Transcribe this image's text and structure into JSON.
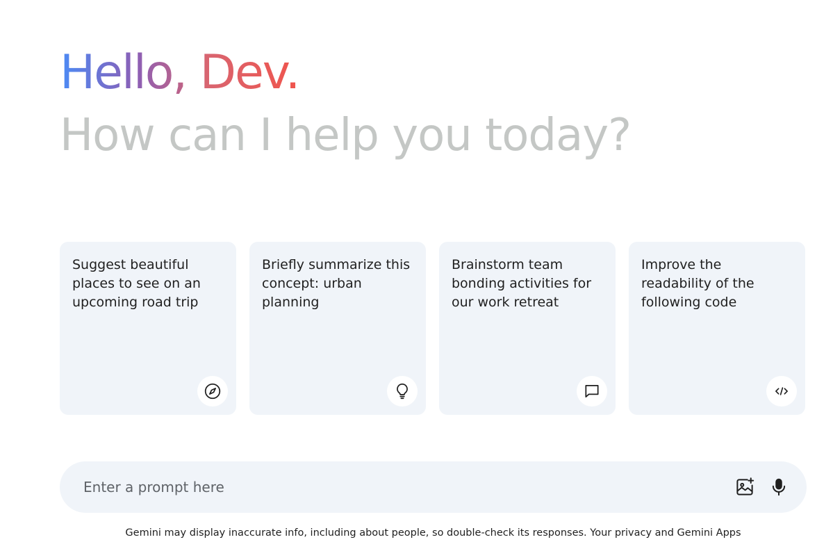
{
  "greeting": {
    "hello": "Hello, Dev.",
    "subtitle": "How can I help you today?",
    "gradient_colors": [
      "#4b8bf5",
      "#8c5fb5",
      "#d96570",
      "#f0544c"
    ]
  },
  "cards": [
    {
      "text": "Suggest beautiful places to see on an upcoming road trip",
      "icon": "compass-icon"
    },
    {
      "text": "Briefly summarize this concept: urban planning",
      "icon": "lightbulb-icon"
    },
    {
      "text": "Brainstorm team bonding activities for our work retreat",
      "icon": "chat-bubble-icon"
    },
    {
      "text": "Improve the readability of the following code",
      "icon": "code-icon"
    }
  ],
  "prompt": {
    "placeholder": "Enter a prompt here",
    "value": "",
    "actions": [
      {
        "icon": "add-image-icon"
      },
      {
        "icon": "microphone-icon"
      }
    ]
  },
  "footer": {
    "disclaimer": "Gemini may display inaccurate info, including about people, so double-check its responses. Your privacy and Gemini Apps"
  },
  "colors": {
    "card_background": "#f0f4f9",
    "subtitle": "#c4c7c5",
    "text": "#1f1f1f",
    "placeholder": "#5f6368"
  }
}
